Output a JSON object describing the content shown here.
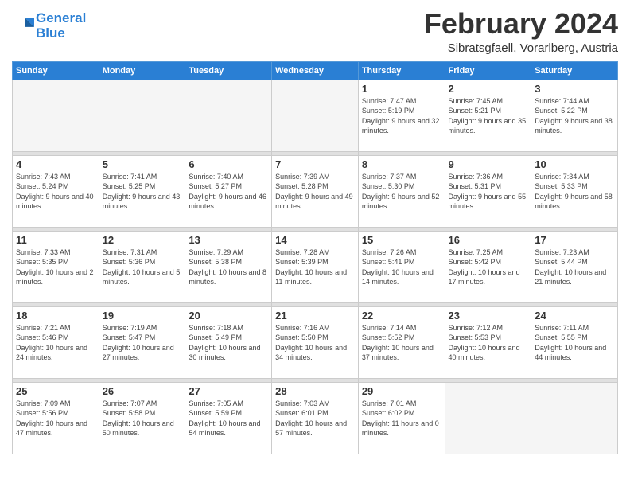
{
  "header": {
    "logo_line1": "General",
    "logo_line2": "Blue",
    "month": "February 2024",
    "location": "Sibratsgfaell, Vorarlberg, Austria"
  },
  "weekdays": [
    "Sunday",
    "Monday",
    "Tuesday",
    "Wednesday",
    "Thursday",
    "Friday",
    "Saturday"
  ],
  "weeks": [
    [
      {
        "day": "",
        "sunrise": "",
        "sunset": "",
        "daylight": "",
        "empty": true
      },
      {
        "day": "",
        "sunrise": "",
        "sunset": "",
        "daylight": "",
        "empty": true
      },
      {
        "day": "",
        "sunrise": "",
        "sunset": "",
        "daylight": "",
        "empty": true
      },
      {
        "day": "",
        "sunrise": "",
        "sunset": "",
        "daylight": "",
        "empty": true
      },
      {
        "day": "1",
        "sunrise": "Sunrise: 7:47 AM",
        "sunset": "Sunset: 5:19 PM",
        "daylight": "Daylight: 9 hours and 32 minutes."
      },
      {
        "day": "2",
        "sunrise": "Sunrise: 7:45 AM",
        "sunset": "Sunset: 5:21 PM",
        "daylight": "Daylight: 9 hours and 35 minutes."
      },
      {
        "day": "3",
        "sunrise": "Sunrise: 7:44 AM",
        "sunset": "Sunset: 5:22 PM",
        "daylight": "Daylight: 9 hours and 38 minutes."
      }
    ],
    [
      {
        "day": "4",
        "sunrise": "Sunrise: 7:43 AM",
        "sunset": "Sunset: 5:24 PM",
        "daylight": "Daylight: 9 hours and 40 minutes."
      },
      {
        "day": "5",
        "sunrise": "Sunrise: 7:41 AM",
        "sunset": "Sunset: 5:25 PM",
        "daylight": "Daylight: 9 hours and 43 minutes."
      },
      {
        "day": "6",
        "sunrise": "Sunrise: 7:40 AM",
        "sunset": "Sunset: 5:27 PM",
        "daylight": "Daylight: 9 hours and 46 minutes."
      },
      {
        "day": "7",
        "sunrise": "Sunrise: 7:39 AM",
        "sunset": "Sunset: 5:28 PM",
        "daylight": "Daylight: 9 hours and 49 minutes."
      },
      {
        "day": "8",
        "sunrise": "Sunrise: 7:37 AM",
        "sunset": "Sunset: 5:30 PM",
        "daylight": "Daylight: 9 hours and 52 minutes."
      },
      {
        "day": "9",
        "sunrise": "Sunrise: 7:36 AM",
        "sunset": "Sunset: 5:31 PM",
        "daylight": "Daylight: 9 hours and 55 minutes."
      },
      {
        "day": "10",
        "sunrise": "Sunrise: 7:34 AM",
        "sunset": "Sunset: 5:33 PM",
        "daylight": "Daylight: 9 hours and 58 minutes."
      }
    ],
    [
      {
        "day": "11",
        "sunrise": "Sunrise: 7:33 AM",
        "sunset": "Sunset: 5:35 PM",
        "daylight": "Daylight: 10 hours and 2 minutes."
      },
      {
        "day": "12",
        "sunrise": "Sunrise: 7:31 AM",
        "sunset": "Sunset: 5:36 PM",
        "daylight": "Daylight: 10 hours and 5 minutes."
      },
      {
        "day": "13",
        "sunrise": "Sunrise: 7:29 AM",
        "sunset": "Sunset: 5:38 PM",
        "daylight": "Daylight: 10 hours and 8 minutes."
      },
      {
        "day": "14",
        "sunrise": "Sunrise: 7:28 AM",
        "sunset": "Sunset: 5:39 PM",
        "daylight": "Daylight: 10 hours and 11 minutes."
      },
      {
        "day": "15",
        "sunrise": "Sunrise: 7:26 AM",
        "sunset": "Sunset: 5:41 PM",
        "daylight": "Daylight: 10 hours and 14 minutes."
      },
      {
        "day": "16",
        "sunrise": "Sunrise: 7:25 AM",
        "sunset": "Sunset: 5:42 PM",
        "daylight": "Daylight: 10 hours and 17 minutes."
      },
      {
        "day": "17",
        "sunrise": "Sunrise: 7:23 AM",
        "sunset": "Sunset: 5:44 PM",
        "daylight": "Daylight: 10 hours and 21 minutes."
      }
    ],
    [
      {
        "day": "18",
        "sunrise": "Sunrise: 7:21 AM",
        "sunset": "Sunset: 5:46 PM",
        "daylight": "Daylight: 10 hours and 24 minutes."
      },
      {
        "day": "19",
        "sunrise": "Sunrise: 7:19 AM",
        "sunset": "Sunset: 5:47 PM",
        "daylight": "Daylight: 10 hours and 27 minutes."
      },
      {
        "day": "20",
        "sunrise": "Sunrise: 7:18 AM",
        "sunset": "Sunset: 5:49 PM",
        "daylight": "Daylight: 10 hours and 30 minutes."
      },
      {
        "day": "21",
        "sunrise": "Sunrise: 7:16 AM",
        "sunset": "Sunset: 5:50 PM",
        "daylight": "Daylight: 10 hours and 34 minutes."
      },
      {
        "day": "22",
        "sunrise": "Sunrise: 7:14 AM",
        "sunset": "Sunset: 5:52 PM",
        "daylight": "Daylight: 10 hours and 37 minutes."
      },
      {
        "day": "23",
        "sunrise": "Sunrise: 7:12 AM",
        "sunset": "Sunset: 5:53 PM",
        "daylight": "Daylight: 10 hours and 40 minutes."
      },
      {
        "day": "24",
        "sunrise": "Sunrise: 7:11 AM",
        "sunset": "Sunset: 5:55 PM",
        "daylight": "Daylight: 10 hours and 44 minutes."
      }
    ],
    [
      {
        "day": "25",
        "sunrise": "Sunrise: 7:09 AM",
        "sunset": "Sunset: 5:56 PM",
        "daylight": "Daylight: 10 hours and 47 minutes."
      },
      {
        "day": "26",
        "sunrise": "Sunrise: 7:07 AM",
        "sunset": "Sunset: 5:58 PM",
        "daylight": "Daylight: 10 hours and 50 minutes."
      },
      {
        "day": "27",
        "sunrise": "Sunrise: 7:05 AM",
        "sunset": "Sunset: 5:59 PM",
        "daylight": "Daylight: 10 hours and 54 minutes."
      },
      {
        "day": "28",
        "sunrise": "Sunrise: 7:03 AM",
        "sunset": "Sunset: 6:01 PM",
        "daylight": "Daylight: 10 hours and 57 minutes."
      },
      {
        "day": "29",
        "sunrise": "Sunrise: 7:01 AM",
        "sunset": "Sunset: 6:02 PM",
        "daylight": "Daylight: 11 hours and 0 minutes."
      },
      {
        "day": "",
        "sunrise": "",
        "sunset": "",
        "daylight": "",
        "empty": true
      },
      {
        "day": "",
        "sunrise": "",
        "sunset": "",
        "daylight": "",
        "empty": true
      }
    ]
  ]
}
